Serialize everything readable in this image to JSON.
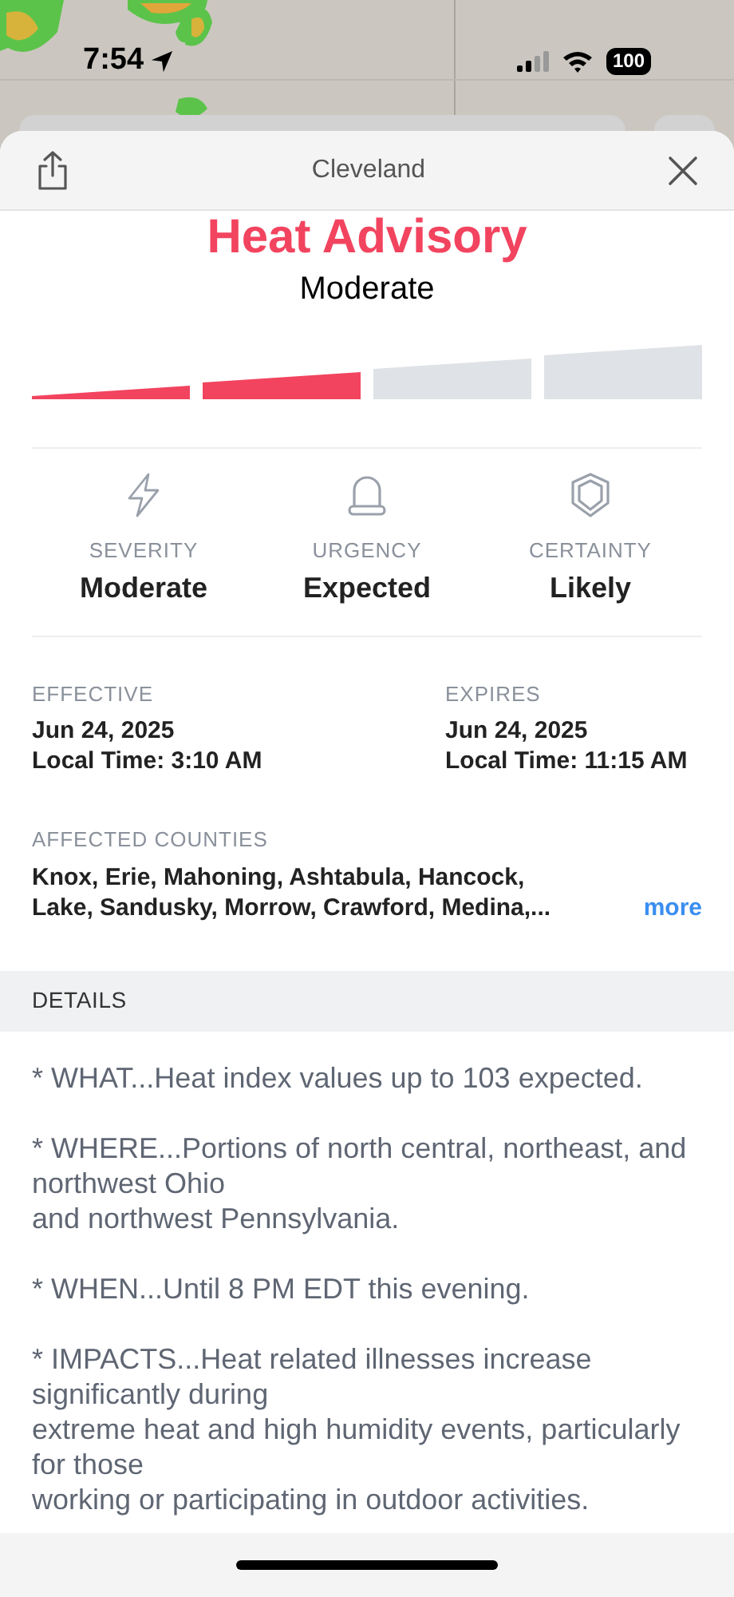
{
  "status_bar": {
    "time": "7:54",
    "battery": "100"
  },
  "sheet": {
    "title": "Cleveland"
  },
  "alert": {
    "title": "Heat Advisory",
    "level_label": "Moderate",
    "meter": {
      "level": 0.5
    }
  },
  "stats": [
    {
      "kind": "severity",
      "label": "SEVERITY",
      "value": "Moderate"
    },
    {
      "kind": "urgency",
      "label": "URGENCY",
      "value": "Expected"
    },
    {
      "kind": "certainty",
      "label": "CERTAINTY",
      "value": "Likely"
    }
  ],
  "times": [
    {
      "label": "EFFECTIVE",
      "date": "Jun 24, 2025",
      "local_time": "Local Time: 3:10 AM"
    },
    {
      "label": "EXPIRES",
      "date": "Jun 24, 2025",
      "local_time": "Local Time: 11:15 AM"
    }
  ],
  "counties": {
    "label": "AFFECTED COUNTIES",
    "lines": [
      "Knox, Erie, Mahoning, Ashtabula, Hancock,",
      "Lake, Sandusky, Morrow, Crawford, Medina,..."
    ],
    "more": "more"
  },
  "details": {
    "header": "DETAILS",
    "paragraphs": [
      [
        "* WHAT...Heat index values up to 103 expected."
      ],
      [
        "* WHERE...Portions of north central, northeast, and northwest Ohio",
        "and northwest Pennsylvania."
      ],
      [
        "* WHEN...Until 8 PM EDT this evening."
      ],
      [
        "* IMPACTS...Heat related illnesses increase significantly during",
        "extreme heat and high humidity events, particularly for those",
        "working or participating in outdoor activities."
      ]
    ]
  }
}
